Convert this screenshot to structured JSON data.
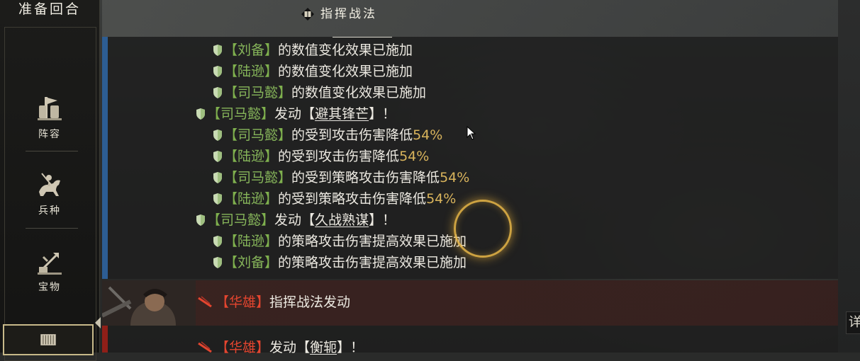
{
  "sidebar": {
    "title": "准备回合",
    "items": [
      {
        "label": "阵容",
        "icon": "formation-icon"
      },
      {
        "label": "兵种",
        "icon": "cavalry-icon"
      },
      {
        "label": "宝物",
        "icon": "treasure-icon"
      }
    ]
  },
  "log": {
    "header_title": "指挥战法",
    "lines": [
      {
        "indent": 2,
        "name": "刘备",
        "text": "的数值变化效果已施加"
      },
      {
        "indent": 2,
        "name": "陆逊",
        "text": "的数值变化效果已施加"
      },
      {
        "indent": 2,
        "name": "司马懿",
        "text": "的数值变化效果已施加"
      },
      {
        "indent": 1,
        "name": "司马懿",
        "pre": "发动",
        "skill": "避其锋芒",
        "post": "！"
      },
      {
        "indent": 2,
        "name": "司马懿",
        "text": "的受到攻击伤害降低",
        "pct": "54%"
      },
      {
        "indent": 2,
        "name": "陆逊",
        "text": "的受到攻击伤害降低",
        "pct": "54%"
      },
      {
        "indent": 2,
        "name": "司马懿",
        "text": "的受到策略攻击伤害降低",
        "pct": "54%"
      },
      {
        "indent": 2,
        "name": "陆逊",
        "text": "的受到策略攻击伤害降低",
        "pct": "54%"
      },
      {
        "indent": 1,
        "name": "司马懿",
        "pre": "发动",
        "skill": "久战熟谋",
        "post": "！"
      },
      {
        "indent": 2,
        "name": "陆逊",
        "text": "的策略攻击伤害提高效果已施加"
      },
      {
        "indent": 2,
        "name": "刘备",
        "text": "的策略攻击伤害提高效果已施加"
      }
    ]
  },
  "enemy": {
    "banner_name": "华雄",
    "banner_text": "指挥战法发动",
    "next_name": "华雄",
    "next_pre": "发动",
    "next_skill": "衡轭",
    "next_post": "！"
  },
  "right_tab": {
    "label": "详"
  },
  "colors": {
    "ally_name": "#86b55a",
    "percent": "#d9b45c",
    "enemy_name": "#e3452f",
    "ally_accent": "#2d5d93",
    "enemy_accent": "#8f1f18"
  }
}
